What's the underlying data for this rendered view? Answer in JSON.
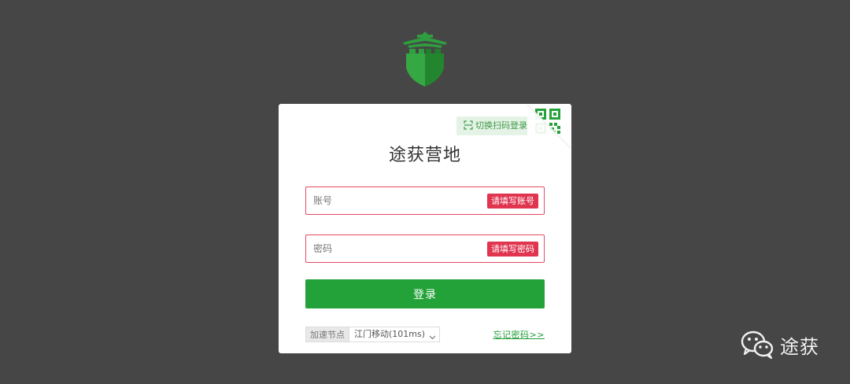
{
  "logo": {
    "icon": "green-fortress-shield-logo",
    "color": "#2d9b3c"
  },
  "card": {
    "title": "途获营地",
    "qr_hint": {
      "label": "切换扫码登录",
      "icon": "scan-icon"
    },
    "qr_corner_icon": "qr-code-icon",
    "account": {
      "placeholder": "账号",
      "value": "",
      "error": "请填写账号"
    },
    "password": {
      "placeholder": "密码",
      "value": "",
      "error": "请填写密码"
    },
    "login_button": "登录",
    "node": {
      "label": "加速节点",
      "selected": "江门移动(101ms)"
    },
    "forgot_password": "忘记密码>>"
  },
  "watermark": {
    "icon": "wechat-icon",
    "text": "途获"
  },
  "colors": {
    "background": "#464646",
    "primary_green": "#22a238",
    "error_red": "#e0344f"
  }
}
